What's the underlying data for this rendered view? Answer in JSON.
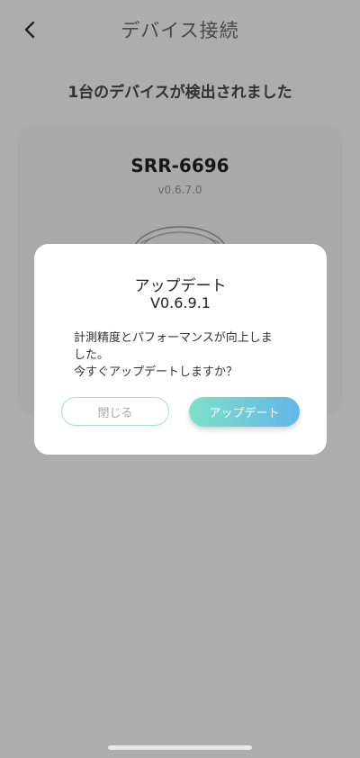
{
  "header": {
    "title": "デバイス接続",
    "back_icon": "chevron-left-icon"
  },
  "main": {
    "found_text": "1台のデバイスが検出されました",
    "device": {
      "name": "SRR-6696",
      "version": "v0.6.7.0",
      "image_icon": "ring-icon"
    }
  },
  "dialog": {
    "title": "アップデート",
    "version": "V0.6.9.1",
    "message": "計測精度とパフォーマンスが向上しま\nした。\n今すぐアップデートしますか？",
    "close_label": "閉じる",
    "update_label": "アップデート",
    "update_gradient": [
      "#7ee0c8",
      "#63b6e8"
    ],
    "close_border_color": "#a6dbe3"
  }
}
